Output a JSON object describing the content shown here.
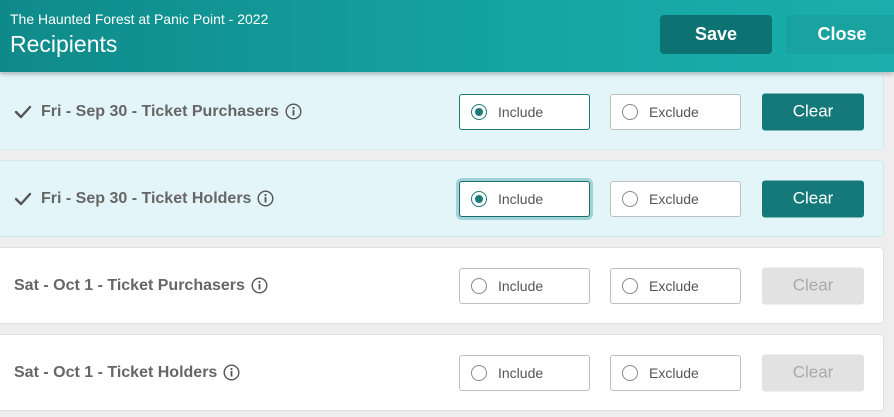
{
  "header": {
    "event_name": "The Haunted Forest at Panic Point - 2022",
    "title": "Recipients",
    "save_label": "Save",
    "close_label": "Close"
  },
  "rows": [
    {
      "label": "Fri - Sep 30 - Ticket Purchasers",
      "selected": true,
      "include_label": "Include",
      "exclude_label": "Exclude",
      "choice": "include",
      "clear_label": "Clear",
      "clear_enabled": true
    },
    {
      "label": "Fri - Sep 30 - Ticket Holders",
      "selected": true,
      "include_label": "Include",
      "exclude_label": "Exclude",
      "choice": "include",
      "clear_label": "Clear",
      "clear_enabled": true
    },
    {
      "label": "Sat - Oct 1 - Ticket Purchasers",
      "selected": false,
      "include_label": "Include",
      "exclude_label": "Exclude",
      "choice": null,
      "clear_label": "Clear",
      "clear_enabled": false
    },
    {
      "label": "Sat - Oct 1 - Ticket Holders",
      "selected": false,
      "include_label": "Include",
      "exclude_label": "Exclude",
      "choice": null,
      "clear_label": "Clear",
      "clear_enabled": false
    }
  ],
  "colors": {
    "header": "#15a5a3",
    "accent": "#157979",
    "selected_row": "#e3f5f9"
  },
  "icons": {
    "check": "check-icon",
    "info": "info-icon",
    "radio": "radio-icon"
  }
}
